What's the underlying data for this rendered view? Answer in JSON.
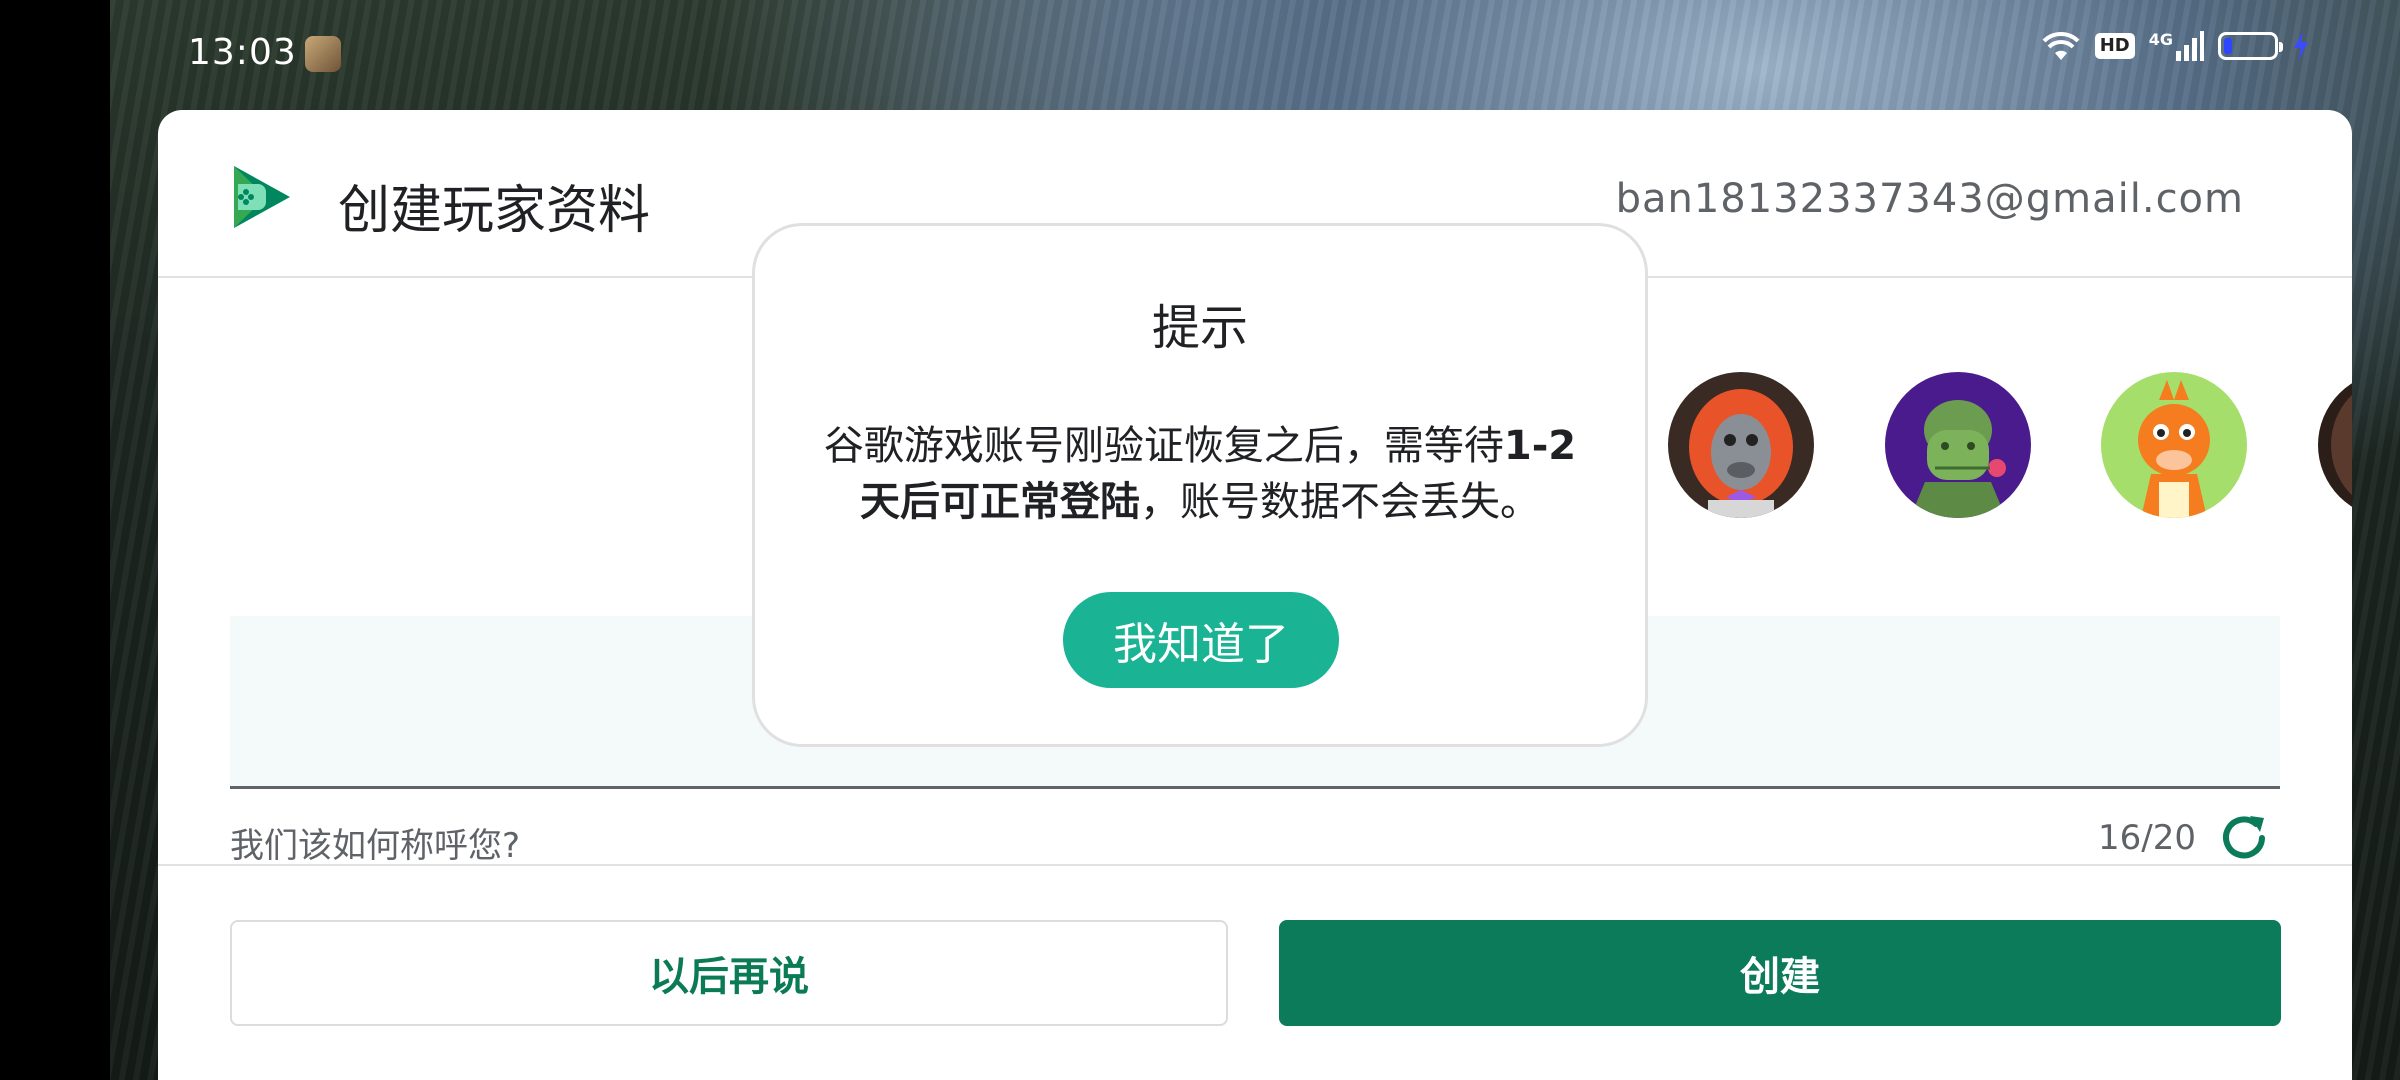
{
  "status_bar": {
    "time": "13:03",
    "hd_badge": "HD",
    "network": "4G",
    "battery_level": 0.2
  },
  "dialog": {
    "title": "创建玩家资料",
    "account_email": "ban18132337343@gmail.com",
    "avatars": [
      "orangutan-avatar",
      "green-soldier-avatar",
      "orange-dragon-avatar",
      "partial-avatar"
    ],
    "name_input": {
      "value": "",
      "helper_text": "我们该如何称呼您?",
      "char_count": "16/20"
    },
    "later_button_label": "以后再说",
    "create_button_label": "创建"
  },
  "alert": {
    "title": "提示",
    "message_part1": "谷歌游戏账号刚验证恢复之后，需等待",
    "message_bold1": "1-2",
    "message_bold2": "天后可正常登陆",
    "message_part2": "，账号数据不会丢失。",
    "ok_button_label": "我知道了"
  },
  "colors": {
    "primary_green": "#0b7b5a",
    "alert_button": "#1ab394",
    "battery_fill": "#2f46ff"
  }
}
